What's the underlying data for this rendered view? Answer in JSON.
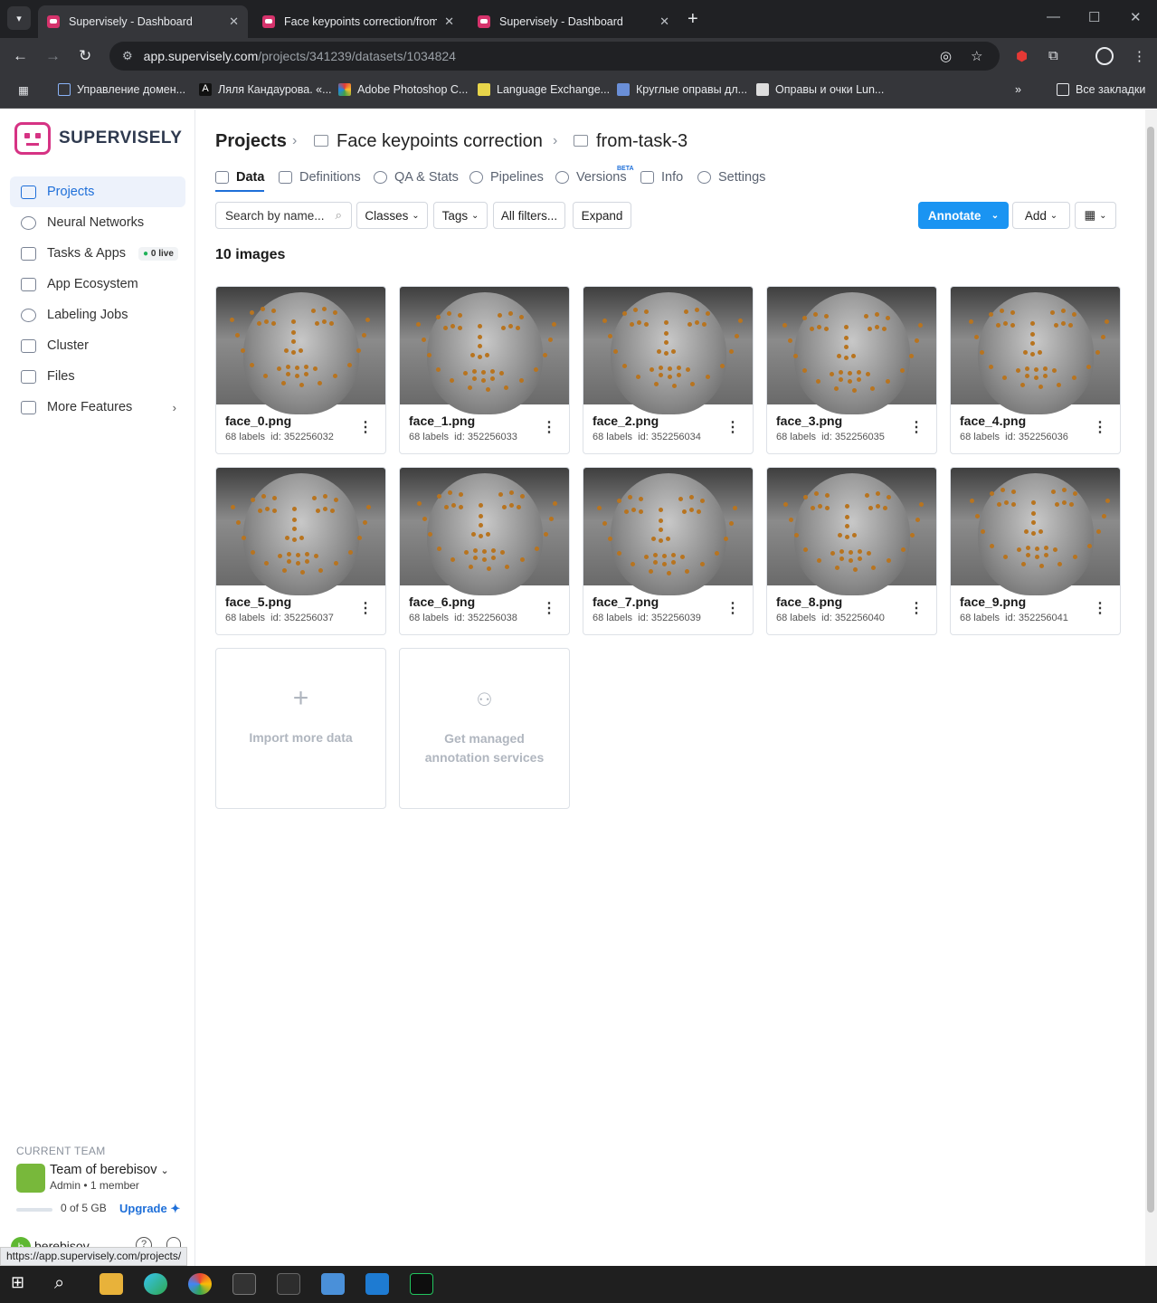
{
  "browser": {
    "tabs": [
      {
        "title": "Supervisely - Dashboard",
        "active": true
      },
      {
        "title": "Face keypoints correction/from",
        "active": false
      },
      {
        "title": "Supervisely - Dashboard",
        "active": false
      }
    ],
    "url_host": "app.supervisely.com",
    "url_path": "/projects/341239/datasets/1034824",
    "bookmarks": [
      "Управление домен...",
      "Ляля Кандаурова. «...",
      "Adobe Photoshop C...",
      "Language Exchange...",
      "Круглые оправы дл...",
      "Оправы и очки Lun..."
    ],
    "all_bookmarks": "Все закладки",
    "status_url": "https://app.supervisely.com/projects/"
  },
  "sidebar": {
    "logo": "SUPERVISELY",
    "items": [
      {
        "label": "Projects",
        "active": true
      },
      {
        "label": "Neural Networks"
      },
      {
        "label": "Tasks & Apps",
        "badge": "0 live"
      },
      {
        "label": "App Ecosystem"
      },
      {
        "label": "Labeling Jobs"
      },
      {
        "label": "Cluster"
      },
      {
        "label": "Files"
      },
      {
        "label": "More Features"
      }
    ],
    "team_label": "CURRENT TEAM",
    "team_name": "Team of berebisov",
    "team_role": "Admin",
    "team_members": "1 member",
    "storage": "0 of 5 GB",
    "upgrade": "Upgrade",
    "user": "berebisov",
    "user_initial": "b"
  },
  "breadcrumb": {
    "root": "Projects",
    "project": "Face keypoints correction",
    "dataset": "from-task-3"
  },
  "tabs": [
    "Data",
    "Definitions",
    "QA & Stats",
    "Pipelines",
    "Versions",
    "Info",
    "Settings"
  ],
  "beta": "BETA",
  "toolbar": {
    "search_placeholder": "Search by name...",
    "classes": "Classes",
    "tags": "Tags",
    "all_filters": "All filters...",
    "expand": "Expand",
    "annotate": "Annotate",
    "add": "Add"
  },
  "image_count": "10 images",
  "images": [
    {
      "name": "face_0.png",
      "labels": "68 labels",
      "id": "id: 352256032"
    },
    {
      "name": "face_1.png",
      "labels": "68 labels",
      "id": "id: 352256033"
    },
    {
      "name": "face_2.png",
      "labels": "68 labels",
      "id": "id: 352256034"
    },
    {
      "name": "face_3.png",
      "labels": "68 labels",
      "id": "id: 352256035"
    },
    {
      "name": "face_4.png",
      "labels": "68 labels",
      "id": "id: 352256036"
    },
    {
      "name": "face_5.png",
      "labels": "68 labels",
      "id": "id: 352256037"
    },
    {
      "name": "face_6.png",
      "labels": "68 labels",
      "id": "id: 352256038"
    },
    {
      "name": "face_7.png",
      "labels": "68 labels",
      "id": "id: 352256039"
    },
    {
      "name": "face_8.png",
      "labels": "68 labels",
      "id": "id: 352256040"
    },
    {
      "name": "face_9.png",
      "labels": "68 labels",
      "id": "id: 352256041"
    }
  ],
  "import_more": "Import more data",
  "managed_line1": "Get managed",
  "managed_line2": "annotation services",
  "colors": {
    "accent": "#1a94f2",
    "brand": "#d63384",
    "keypoint": "#b8741f"
  }
}
